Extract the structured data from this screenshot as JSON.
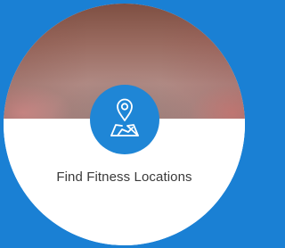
{
  "card": {
    "label": "Find Fitness Locations",
    "icon": "map-location-pin-icon"
  },
  "colors": {
    "background": "#1a80d4",
    "icon_circle": "#1f86d6",
    "label_text": "#3a3a3a",
    "card_fill": "#ffffff"
  }
}
